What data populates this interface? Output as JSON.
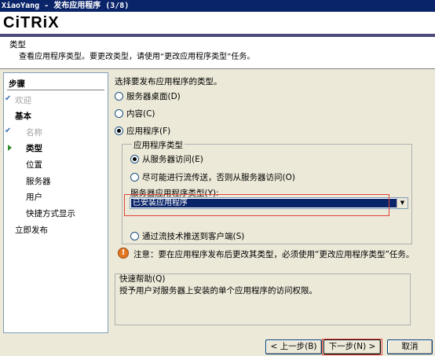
{
  "window": {
    "title": "XiaoYang - 发布应用程序 (3/8)"
  },
  "brand": {
    "logo_text": "CiTRiX"
  },
  "page": {
    "title": "类型",
    "description": "查看应用程序类型。要更改类型，请使用“更改应用程序类型”任务。"
  },
  "steps": {
    "heading": "步骤",
    "items": [
      {
        "label": "欢迎",
        "state": "done"
      },
      {
        "label": "基本",
        "state": "section"
      },
      {
        "label": "名称",
        "state": "done"
      },
      {
        "label": "类型",
        "state": "current"
      },
      {
        "label": "位置",
        "state": "pending"
      },
      {
        "label": "服务器",
        "state": "pending"
      },
      {
        "label": "用户",
        "state": "pending"
      },
      {
        "label": "快捷方式显示",
        "state": "pending"
      },
      {
        "label": "立即发布",
        "state": "pending"
      }
    ]
  },
  "main": {
    "prompt": "选择要发布应用程序的类型。",
    "types": {
      "server_desktop": "服务器桌面(D)",
      "content": "内容(C)",
      "application": "应用程序(F)"
    },
    "selected_type": "application",
    "app_type_group": {
      "legend": "应用程序类型",
      "access_from_server": "从服务器访问(E)",
      "stream_else_server": "尽可能进行流传送，否则从服务器访问(O)",
      "server_app_type_label": "服务器应用程序类型(Y):",
      "server_app_type_value": "已安装应用程序",
      "stream_to_client": "通过流技术推送到客户端(S)",
      "selected": "access_from_server"
    },
    "warning": "注意：要在应用程序发布后更改其类型，必须使用“更改应用程序类型”任务。"
  },
  "help": {
    "legend": "快速帮助(Q)",
    "text": "授予用户对服务器上安装的单个应用程序的访问权限。"
  },
  "buttons": {
    "back": "< 上一步(B)",
    "next": "下一步(N) >",
    "cancel": "取消"
  },
  "colors": {
    "titlebar": "#0a246a",
    "accent_bar": "#4b4a7a",
    "highlight": "#e0443c",
    "warning": "#e27722"
  }
}
